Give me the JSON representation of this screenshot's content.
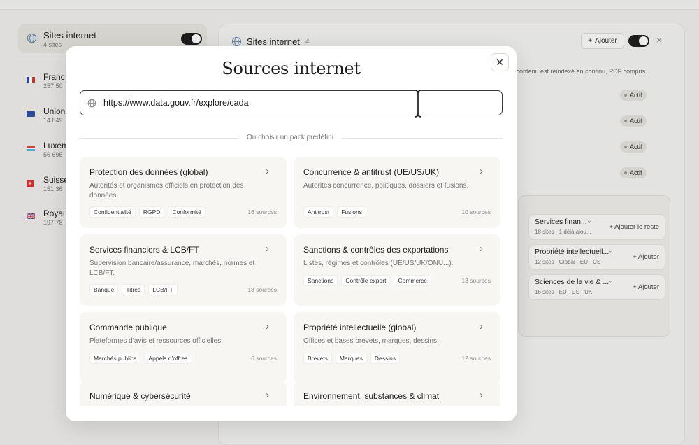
{
  "left_panel": {
    "header": {
      "title": "Sites internet",
      "subtitle": "4 sites",
      "icon": "globe-icon"
    },
    "items": [
      {
        "name": "Franc",
        "count": "257 50",
        "flag": "france"
      },
      {
        "name": "Union",
        "count": "14 849",
        "flag": "eu"
      },
      {
        "name": "Luxem",
        "count": "56 695",
        "flag": "luxembourg"
      },
      {
        "name": "Suisse",
        "count": "151 36",
        "flag": "switzerland"
      },
      {
        "name": "Royau",
        "count": "197 78",
        "flag": "uk"
      }
    ]
  },
  "right_panel": {
    "title": "Sites internet",
    "count": "4",
    "add_label": "Ajouter",
    "description": "r contenu est réindexé en continu, PDF compris.",
    "status_badges": [
      "Actif",
      "Actif",
      "Actif",
      "Actif"
    ],
    "packs": [
      {
        "name": "Services finan...",
        "meta": "18 sites · 1 déjà ajou...",
        "action": "Ajouter le reste"
      },
      {
        "name": "Propriété intellectuell...",
        "meta": "12 sites · Global · EU · US",
        "action": "Ajouter"
      },
      {
        "name": "Sciences de la vie & ...",
        "meta": "16 sites · EU · US · UK",
        "action": "Ajouter"
      }
    ]
  },
  "modal": {
    "title": "Sources internet",
    "url_value": "https://www.data.gouv.fr/explore/cada",
    "separator_label": "Ou choisir un pack prédéfini",
    "cards": [
      {
        "title": "Protection des données (global)",
        "description": "Autorités et organismes officiels en protection des données.",
        "tags": [
          "Confidentialité",
          "RGPD",
          "Conformité"
        ],
        "count": "16 sources"
      },
      {
        "title": "Concurrence & antitrust (UE/US/UK)",
        "description": "Autorités concurrence, politiques, dossiers et fusions.",
        "tags": [
          "Antitrust",
          "Fusions"
        ],
        "count": "10 sources"
      },
      {
        "title": "Services financiers & LCB/FT",
        "description": "Supervision bancaire/assurance, marchés, normes et LCB/FT.",
        "tags": [
          "Banque",
          "Titres",
          "LCB/FT"
        ],
        "count": "18 sources"
      },
      {
        "title": "Sanctions & contrôles des exportations",
        "description": "Listes, régimes et contrôles (UE/US/UK/ONU...).",
        "tags": [
          "Sanctions",
          "Contrôle export",
          "Commerce"
        ],
        "count": "13 sources"
      },
      {
        "title": "Commande publique",
        "description": "Plateformes d’avis et ressources officielles.",
        "tags": [
          "Marchés publics",
          "Appels d’offres"
        ],
        "count": "6 sources"
      },
      {
        "title": "Propriété intellectuelle (global)",
        "description": "Offices et bases brevets, marques, dessins.",
        "tags": [
          "Brevets",
          "Marques",
          "Dessins"
        ],
        "count": "12 sources"
      },
      {
        "title": "Numérique & cybersécurité",
        "description": "",
        "tags": [],
        "count": ""
      },
      {
        "title": "Environnement, substances & climat",
        "description": "",
        "tags": [],
        "count": ""
      }
    ]
  },
  "colors": {
    "accent": "#1d1d1d",
    "card_bg": "#f7f6f3",
    "muted_text": "#747474"
  }
}
